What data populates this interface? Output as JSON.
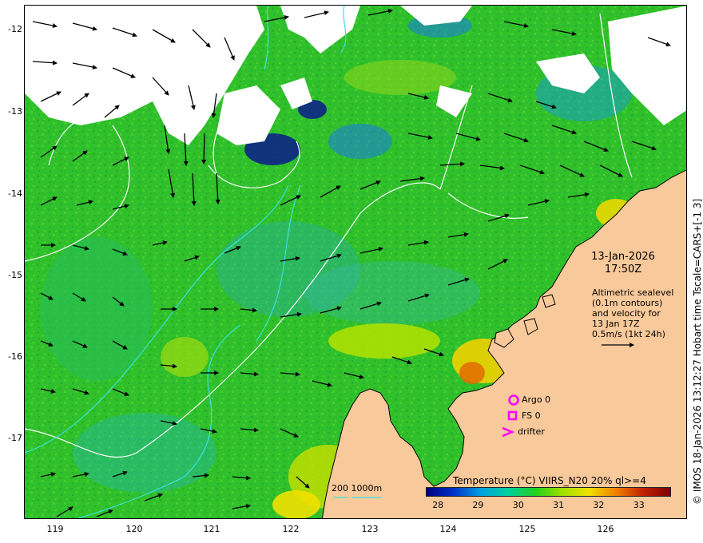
{
  "latitude_labels": [
    "-12",
    "-13",
    "-14",
    "-15",
    "-16",
    "-17"
  ],
  "longitude_labels": [
    "119",
    "120",
    "121",
    "122",
    "123",
    "124",
    "125",
    "126"
  ],
  "timestamp": {
    "date": "13-Jan-2026",
    "time": "17:50Z"
  },
  "altimetry_note": [
    "Altimetric sealevel",
    "(0.1m contours)",
    "and velocity for",
    "13 Jan 17Z",
    "0.5m/s (1kt 24h)"
  ],
  "legend": {
    "argo": "Argo 0",
    "fs": "FS 0",
    "drifter": "drifter"
  },
  "bathymetry_scale_label": "200  1000m",
  "colorbar": {
    "title": "Temperature (°C) VIIRS_N20 20% ql>=4",
    "ticks": [
      "28",
      "29",
      "30",
      "31",
      "32",
      "33"
    ],
    "range": [
      27.7,
      33.8
    ],
    "colors": [
      "#000080",
      "#0030c8",
      "#00a0e0",
      "#00d0a0",
      "#20d020",
      "#a0e000",
      "#f0e000",
      "#f08000",
      "#c02000",
      "#800000"
    ]
  },
  "side_caption": "© IMOS 18-Jan-2026 13:12:27 Hobart time Tscale=CARS+[-1 3]",
  "colors": {
    "ocean_green": "#2fc02b",
    "land": "#f8c99a",
    "cloud": "#ffffff",
    "contour": "#ffffff",
    "isobath": "#39e0e0",
    "marker_magenta": "#ff00ff"
  },
  "icons": {
    "argo": "circle-icon",
    "fs": "square-icon",
    "drifter": "chevron-icon",
    "velocity_scale": "arrow-icon"
  }
}
